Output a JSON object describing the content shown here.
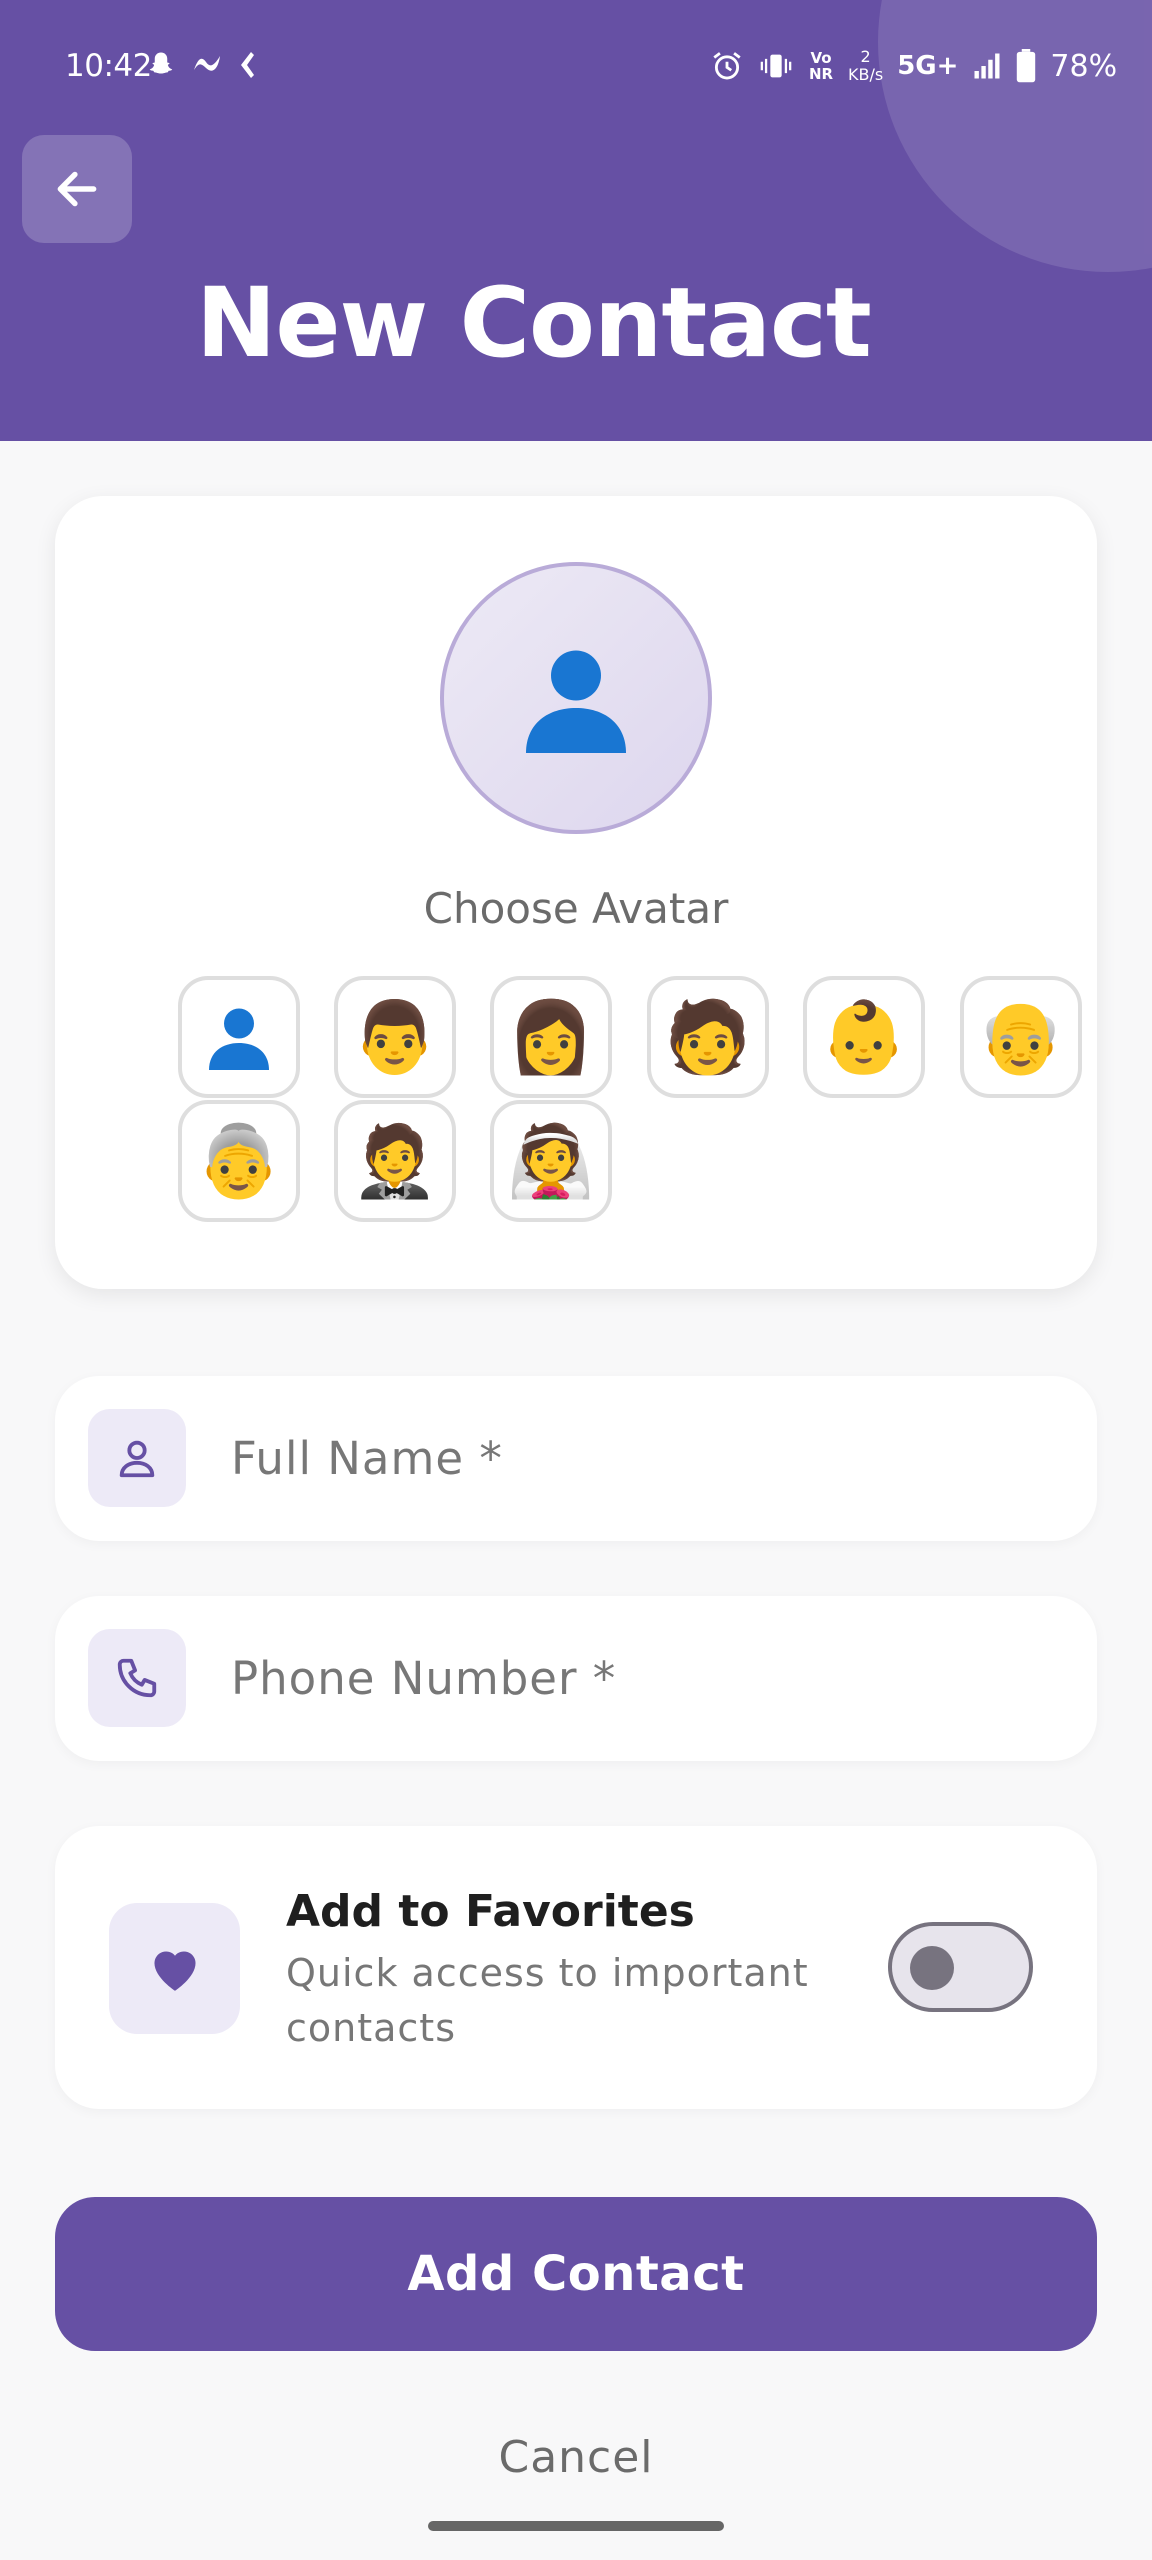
{
  "status_bar": {
    "time": "10:42",
    "network": "5G+",
    "speed_value": "2",
    "speed_unit": "KB/s",
    "volte": "Vo NR",
    "battery_pct": "78%"
  },
  "header": {
    "title": "New Contact",
    "bg_color": "#6650A4"
  },
  "avatar_picker": {
    "selected_icon": "👤",
    "label": "Choose Avatar",
    "options": [
      "👤",
      "👨",
      "👩",
      "🧑",
      "👶",
      "👴",
      "👵",
      "🤵",
      "👰"
    ]
  },
  "form": {
    "name_placeholder": "Full Name *",
    "phone_placeholder": "Phone Number *"
  },
  "favorites": {
    "title": "Add to Favorites",
    "subtitle": "Quick access to important contacts",
    "enabled": false
  },
  "actions": {
    "add_label": "Add Contact",
    "cancel_label": "Cancel"
  }
}
